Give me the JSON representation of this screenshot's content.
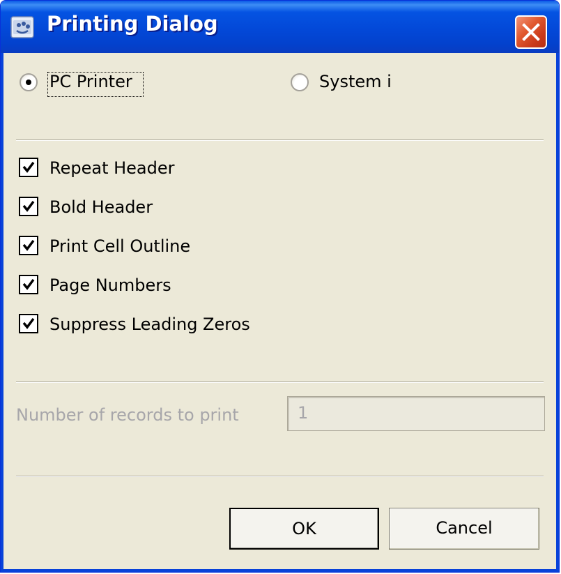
{
  "window": {
    "title": "Printing Dialog",
    "app_icon": "java-cup-icon",
    "close_icon": "close-icon"
  },
  "printer_choice": {
    "options": [
      {
        "label": "PC Printer",
        "selected": true
      },
      {
        "label": "System i",
        "selected": false
      }
    ]
  },
  "options": [
    {
      "label": "Repeat Header",
      "checked": true
    },
    {
      "label": "Bold Header",
      "checked": true
    },
    {
      "label": "Print Cell Outline",
      "checked": true
    },
    {
      "label": "Page Numbers",
      "checked": true
    },
    {
      "label": "Suppress Leading Zeros",
      "checked": true
    }
  ],
  "records": {
    "label": "Number of records to print",
    "value": "1",
    "enabled": false
  },
  "buttons": {
    "ok": "OK",
    "cancel": "Cancel"
  },
  "colors": {
    "titlebar": "#0453e2",
    "dialog_bg": "#ece9d8",
    "close_button": "#e1592e",
    "disabled_text": "#a7a6aa"
  }
}
